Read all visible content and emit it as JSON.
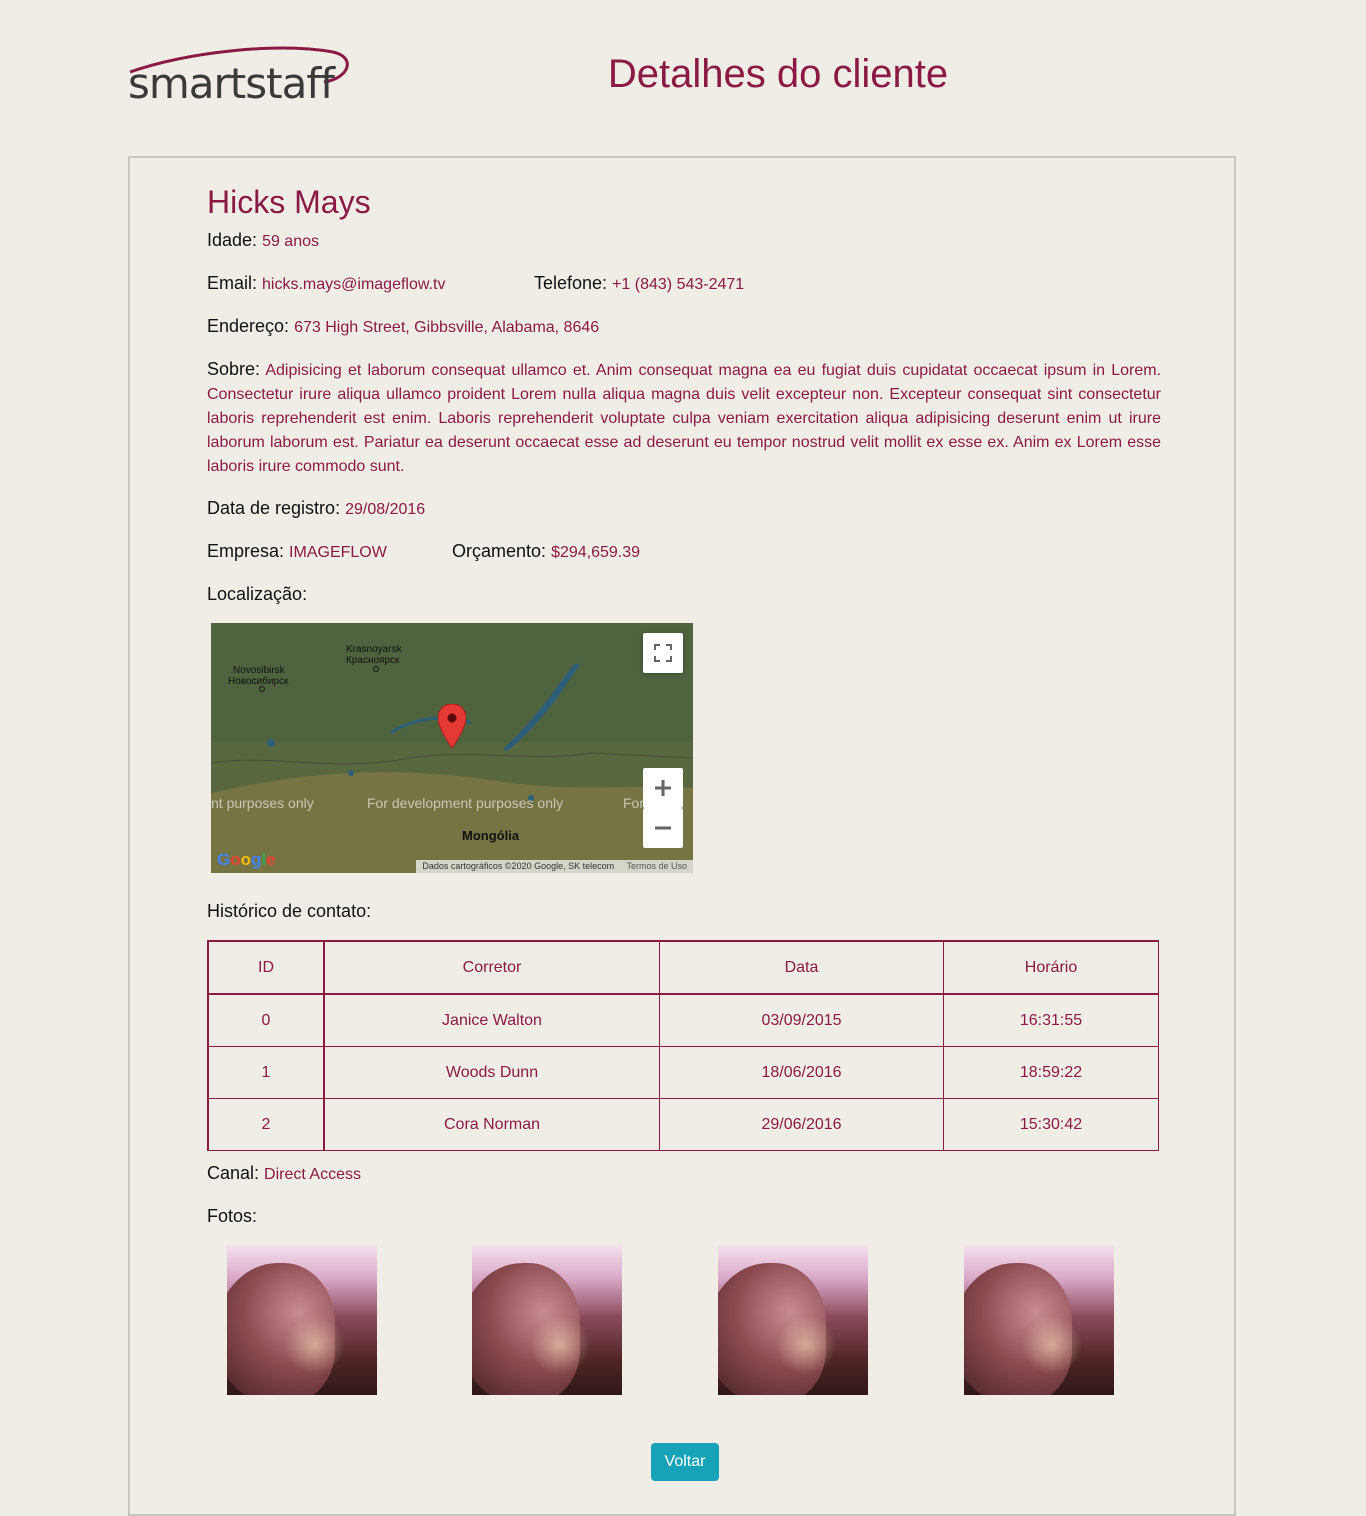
{
  "header": {
    "logo_part1": "smart",
    "logo_part2": "staff",
    "title": "Detalhes do cliente"
  },
  "client": {
    "name": "Hicks Mays",
    "age_label": "Idade:",
    "age_value": "59 anos",
    "email_label": "Email:",
    "email_value": "hicks.mays@imageflow.tv",
    "phone_label": "Telefone:",
    "phone_value": "+1 (843) 543-2471",
    "address_label": "Endereço:",
    "address_value": "673 High Street, Gibbsville, Alabama, 8646",
    "about_label": "Sobre:",
    "about_value": "Adipisicing et laborum consequat ullamco et. Anim consequat magna ea eu fugiat duis cupidatat occaecat ipsum in Lorem. Consectetur irure aliqua ullamco proident Lorem nulla aliqua magna duis velit excepteur non. Excepteur consequat sint consectetur laboris reprehenderit est enim. Laboris reprehenderit voluptate culpa veniam exercitation aliqua adipisicing deserunt enim ut irure laborum laborum est. Pariatur ea deserunt occaecat esse ad deserunt eu tempor nostrud velit mollit ex esse ex. Anim ex Lorem esse laboris irure commodo sunt.",
    "registered_label": "Data de registro:",
    "registered_value": "29/08/2016",
    "company_label": "Empresa:",
    "company_value": "IMAGEFLOW",
    "budget_label": "Orçamento:",
    "budget_value": "$294,659.39",
    "location_label": "Localização:",
    "history_label": "Histórico de contato:",
    "channel_label": "Canal:",
    "channel_value": "Direct Access",
    "photos_label": "Fotos:"
  },
  "map": {
    "labels": {
      "krasnoyarsk": "Krasnoyarsk",
      "krasnoyarsk_ru": "Красноярск",
      "novosibirsk": "Novosibirsk",
      "novosibirsk_ru": "Новосибирск",
      "mongolia": "Mongólia"
    },
    "watermark_left": "nt purposes only",
    "watermark_center": "For development purposes only",
    "watermark_right": "For d...o",
    "attribution": "Dados cartográficos ©2020 Google, SK telecom",
    "terms": "Termos de Uso",
    "google": "Google",
    "colors": {
      "land": "#59673f",
      "water": "#2e5f7a",
      "pin": "#e53935"
    }
  },
  "history_table": {
    "columns": [
      "ID",
      "Corretor",
      "Data",
      "Horário"
    ],
    "rows": [
      [
        "0",
        "Janice Walton",
        "03/09/2015",
        "16:31:55"
      ],
      [
        "1",
        "Woods Dunn",
        "18/06/2016",
        "18:59:22"
      ],
      [
        "2",
        "Cora Norman",
        "29/06/2016",
        "15:30:42"
      ]
    ]
  },
  "actions": {
    "back_label": "Voltar"
  },
  "colors": {
    "accent": "#8a1a45",
    "background": "#f0ede6",
    "button": "#17a2b8"
  }
}
